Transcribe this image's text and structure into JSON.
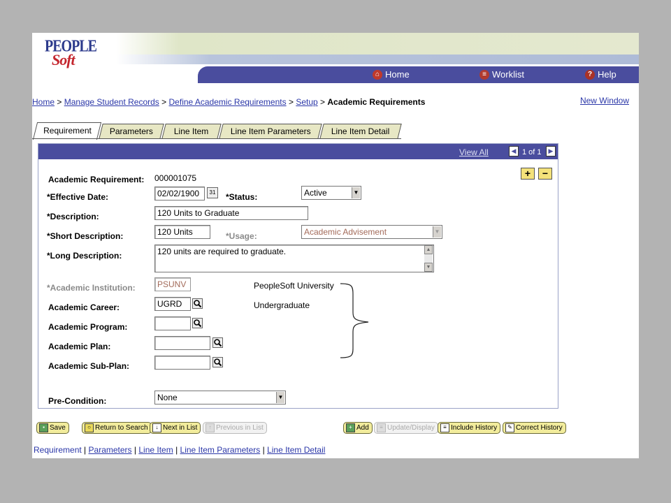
{
  "header": {
    "logo_line1": "PEOPLE",
    "logo_line2": "Soft",
    "nav": [
      {
        "label": "Home",
        "icon": "home-icon"
      },
      {
        "label": "Worklist",
        "icon": "worklist-icon"
      },
      {
        "label": "Help",
        "icon": "help-icon"
      }
    ]
  },
  "breadcrumb": {
    "links": [
      "Home",
      "Manage Student Records",
      "Define Academic Requirements",
      "Setup"
    ],
    "separator": ">",
    "current": "Academic Requirements"
  },
  "new_window": "New Window",
  "tabs": [
    "Requirement",
    "Parameters",
    "Line Item",
    "Line Item Parameters",
    "Line Item Detail"
  ],
  "panel": {
    "view_all": "View All",
    "count": "1 of 1",
    "add_row": "+",
    "delete_row": "−"
  },
  "form": {
    "academic_requirement": {
      "label": "Academic Requirement:",
      "value": "000001075"
    },
    "effective_date": {
      "label": "*Effective Date:",
      "value": "02/02/1900",
      "calendar": "31"
    },
    "status": {
      "label": "*Status:",
      "value": "Active"
    },
    "description": {
      "label": "*Description:",
      "value": "120 Units to Graduate"
    },
    "short_description": {
      "label": "*Short Description:",
      "value": "120 Units"
    },
    "usage": {
      "label": "*Usage:",
      "value": "Academic Advisement"
    },
    "long_description": {
      "label": "*Long Description:",
      "value": "120 units are required to graduate."
    },
    "academic_institution": {
      "label": "*Academic Institution:",
      "value": "PSUNV",
      "desc": "PeopleSoft University"
    },
    "academic_career": {
      "label": "Academic Career:",
      "value": "UGRD",
      "desc": "Undergraduate"
    },
    "academic_program": {
      "label": "Academic Program:",
      "value": ""
    },
    "academic_plan": {
      "label": "Academic Plan:",
      "value": ""
    },
    "academic_subplan": {
      "label": "Academic Sub-Plan:",
      "value": ""
    },
    "pre_condition": {
      "label": "Pre-Condition:",
      "value": "None"
    }
  },
  "buttons": {
    "save": "Save",
    "return_to_search": "Return to Search",
    "next_in_list": "Next in List",
    "previous_in_list": "Previous in List",
    "add": "Add",
    "update_display": "Update/Display",
    "include_history": "Include History",
    "correct_history": "Correct History"
  },
  "bottom_nav": {
    "current": "Requirement",
    "links": [
      "Parameters",
      "Line Item",
      "Line Item Parameters",
      "Line Item Detail"
    ],
    "separator": "|"
  }
}
